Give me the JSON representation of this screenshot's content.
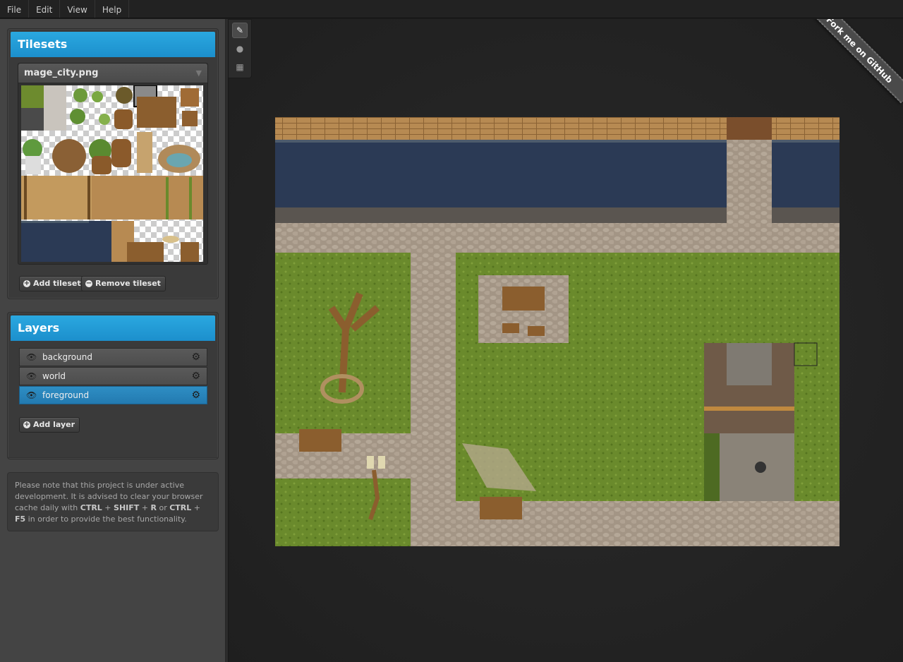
{
  "menu": [
    "File",
    "Edit",
    "View",
    "Help"
  ],
  "tilesets": {
    "title": "Tilesets",
    "selected": "mage_city.png",
    "add_label": "Add tileset",
    "remove_label": "Remove tileset"
  },
  "layers": {
    "title": "Layers",
    "items": [
      {
        "name": "background",
        "active": false
      },
      {
        "name": "world",
        "active": false
      },
      {
        "name": "foreground",
        "active": true
      }
    ],
    "add_label": "Add layer"
  },
  "notice": {
    "text1": "Please note that this project is under active development. It is advised to clear your browser cache daily with ",
    "key1": "CTRL",
    "plus": " + ",
    "key2": "SHIFT",
    "key3": "R",
    "or": " or ",
    "key4": "CTRL",
    "key5": "F5",
    "text2": " in order to provide the best functionality."
  },
  "tools": [
    "pencil-icon",
    "fill-icon",
    "grid-icon"
  ],
  "ribbon": "Fork me on GitHub",
  "colors": {
    "accent": "#1c9bd9",
    "active_layer": "#2785bc",
    "water": "#2b3a55",
    "grass": "#6a8a2c",
    "cobble": "#a39585",
    "brick": "#b78a52"
  }
}
